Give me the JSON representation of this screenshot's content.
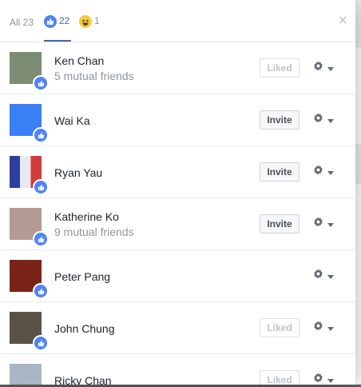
{
  "tabs": {
    "all_label": "All 23",
    "like_count": "22",
    "haha_count": "1",
    "close_glyph": "×"
  },
  "people": [
    {
      "name": "Ken Chan",
      "mutual": "5 mutual friends",
      "action": "Liked",
      "avatar_color": "#7c8b73"
    },
    {
      "name": "Wai Ka",
      "mutual": "",
      "action": "Invite",
      "avatar_color": "#3a7ff5"
    },
    {
      "name": "Ryan Yau",
      "mutual": "",
      "action": "Invite",
      "avatar_color": "#9aa4c8"
    },
    {
      "name": "Katherine Ko",
      "mutual": "9 mutual friends",
      "action": "Invite",
      "avatar_color": "#b39b93"
    },
    {
      "name": "Peter Pang",
      "mutual": "",
      "action": "",
      "avatar_color": "#7a2418"
    },
    {
      "name": "John Chung",
      "mutual": "",
      "action": "Liked",
      "avatar_color": "#5b5247"
    },
    {
      "name": "Ricky Chan",
      "mutual": "",
      "action": "Liked",
      "avatar_color": "#a9b4c4"
    }
  ],
  "background": {
    "bottom_link": "http://www.thandmac.com/... how to use facebook reactions/"
  },
  "colors": {
    "accent": "#4267b2",
    "like_blue": "#4e84f3",
    "haha_yellow": "#f7c93f"
  }
}
